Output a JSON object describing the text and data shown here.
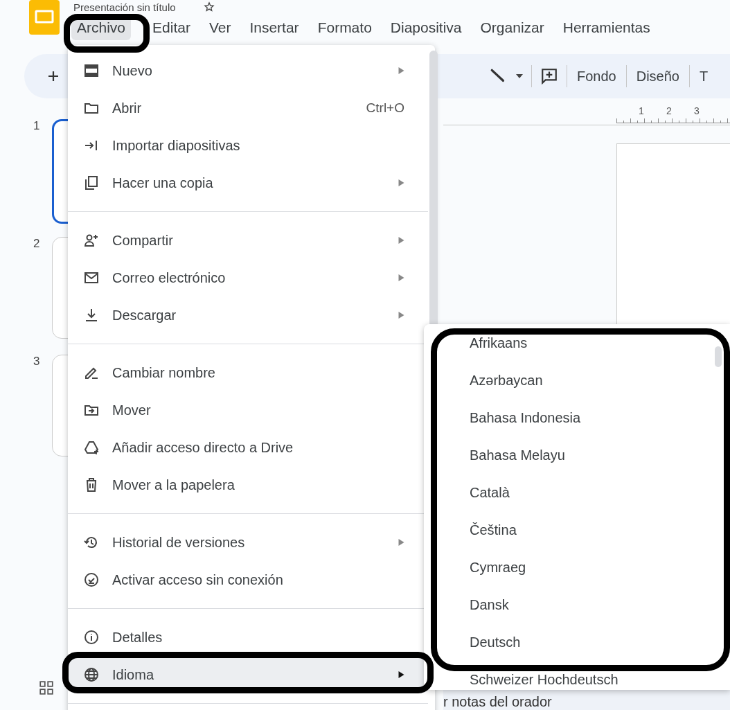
{
  "document_title": "Presentación sin título",
  "menubar": [
    {
      "label": "Archivo",
      "selected": true
    },
    {
      "label": "Editar",
      "selected": false
    },
    {
      "label": "Ver",
      "selected": false
    },
    {
      "label": "Insertar",
      "selected": false
    },
    {
      "label": "Formato",
      "selected": false
    },
    {
      "label": "Diapositiva",
      "selected": false
    },
    {
      "label": "Organizar",
      "selected": false
    },
    {
      "label": "Herramientas",
      "selected": false
    }
  ],
  "toolbar": {
    "buttons": [
      "Fondo",
      "Diseño",
      "T"
    ]
  },
  "ruler": {
    "marks": [
      "1",
      "2",
      "3"
    ]
  },
  "filmstrip": [
    {
      "number": "1",
      "selected": true
    },
    {
      "number": "2",
      "selected": false
    },
    {
      "number": "3",
      "selected": false
    }
  ],
  "file_menu": {
    "groups": [
      [
        {
          "label": "Nuevo",
          "submenu": true,
          "selected": false
        },
        {
          "label": "Abrir",
          "shortcut": "Ctrl+O",
          "submenu": false,
          "selected": false
        },
        {
          "label": "Importar diapositivas",
          "submenu": false,
          "selected": false
        },
        {
          "label": "Hacer una copia",
          "submenu": true,
          "selected": false
        }
      ],
      [
        {
          "label": "Compartir",
          "submenu": true,
          "selected": false
        },
        {
          "label": "Correo electrónico",
          "submenu": true,
          "selected": false
        },
        {
          "label": "Descargar",
          "submenu": true,
          "selected": false
        }
      ],
      [
        {
          "label": "Cambiar nombre",
          "submenu": false,
          "selected": false
        },
        {
          "label": "Mover",
          "submenu": false,
          "selected": false
        },
        {
          "label": "Añadir acceso directo a Drive",
          "submenu": false,
          "selected": false
        },
        {
          "label": "Mover a la papelera",
          "submenu": false,
          "selected": false
        }
      ],
      [
        {
          "label": "Historial de versiones",
          "submenu": true,
          "selected": false
        },
        {
          "label": "Activar acceso sin conexión",
          "submenu": false,
          "selected": false
        }
      ],
      [
        {
          "label": "Detalles",
          "submenu": false,
          "selected": false
        },
        {
          "label": "Idioma",
          "submenu": true,
          "selected": true
        }
      ]
    ]
  },
  "language_menu": [
    "Afrikaans",
    "Azərbaycan",
    "Bahasa Indonesia",
    "Bahasa Melayu",
    "Català",
    "Čeština",
    "Cymraeg",
    "Dansk",
    "Deutsch",
    "Schweizer Hochdeutsch"
  ],
  "speaker_notes": "r notas del orador"
}
